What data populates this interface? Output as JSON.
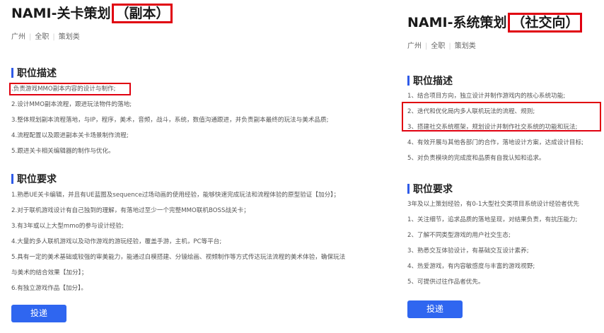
{
  "left": {
    "title_main": "NAMI-关卡策划",
    "title_tag": "（副本）",
    "meta": [
      "广州",
      "全职",
      "策划类"
    ],
    "description_heading": "职位描述",
    "description": [
      ".负责游戏MMO副本内容的设计与制作;",
      "2.设计MMO副本流程，跟进玩法物件的落地;",
      "3.整体规划副本流程落地，与IP，程序，美术，音频，战斗，系统，数值沟通跟进，并负责副本最终的玩法与美术品质;",
      "4.流程配置以及跟进副本关卡场景制作流程;",
      "5.跟进关卡相关编辑器的制作与优化。"
    ],
    "requirements_heading": "职位要求",
    "requirements": [
      "1.熟悉UE关卡编辑，并且有UE蓝图及sequence过场动画的使用经验，能够快速完成玩法和流程体验的原型验证【加分】；",
      "2.对于联机游戏设计有自己独到的理解，有落地过至少一个完整MMO联机BOSS战关卡；",
      "3.有3年或以上大型mmo的参与设计经验;",
      "4.大量的多人联机游戏以及动作游戏的游玩经验，覆盖手游，主机，PC等平台;",
      "5.具有一定的美术基础或较强的审美能力，能通过白模搭建、分镜绘画、视频制作等方式传达玩法流程的美术体验，确保玩法",
      "与美术的结合效果【加分】；",
      "6.有独立游戏作品【加分】。"
    ],
    "apply_label": "投递"
  },
  "right": {
    "title_main": "NAMI-系统策划",
    "title_tag": "（社交向）",
    "meta": [
      "广州",
      "全职",
      "策划类"
    ],
    "description_heading": "职位描述",
    "description": [
      "1、结合项目方向，独立设计并制作游戏内的核心系统功能;",
      "2、迭代和优化局内多人联机玩法的流程、规则;",
      "3、搭建社交系统框架，规划设计并制作社交系统的功能和玩法;",
      "4、有效开展与其他各部门的合作，落地设计方案，达成设计目标;",
      "5、对负责模块的完成度和品质有自我认知和追求。"
    ],
    "requirements_heading": "职位要求",
    "requirements": [
      "3年及以上策划经验，有0-1大型社交类项目系统设计经验者优先",
      "1、关注细节，追求品质的落地呈现，对结果负责，有抗压能力;",
      "2、了解不同类型游戏的用户社交生态;",
      "3、熟悉交互体验设计，有基础交互设计素养;",
      "4、热爱游戏，有内容敏感度与丰富的游戏视野;",
      "5、可提供过往作品者优先。"
    ],
    "apply_label": "投递"
  },
  "colors": {
    "highlight": "#e00010",
    "accent": "#2f5be8",
    "button": "#2f66f0"
  }
}
